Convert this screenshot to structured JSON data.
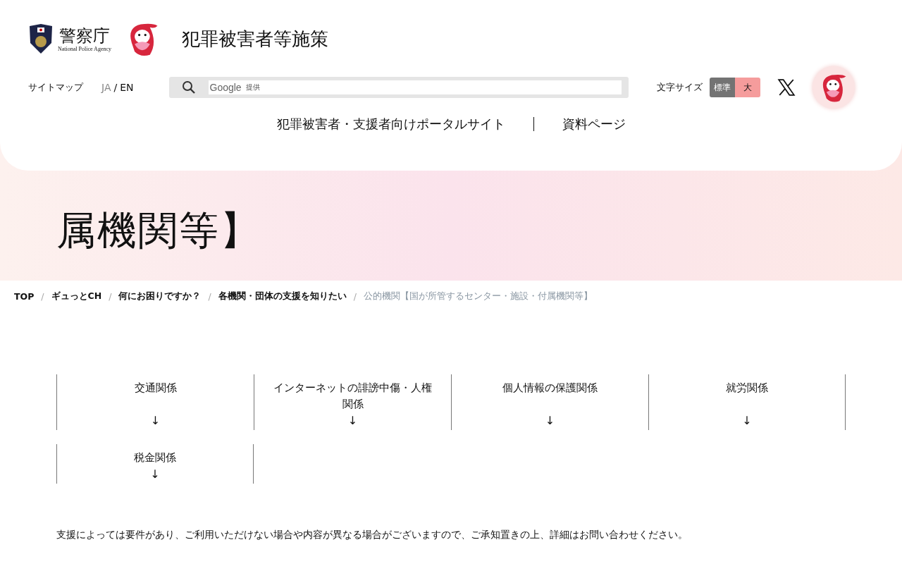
{
  "header": {
    "agency_name": "警察庁",
    "agency_subtitle": "National Police Agency",
    "site_title": "犯罪被害者等施策",
    "utility": {
      "sitemap": "サイトマップ",
      "languages": [
        {
          "label": "JA",
          "selected": true
        },
        {
          "label": "EN",
          "selected": false
        }
      ],
      "language_separator": "/",
      "search": {
        "provider": "Google",
        "provider_note": "提供"
      },
      "font_size": {
        "label": "文字サイズ",
        "options": [
          {
            "label": "標準",
            "selected": true
          },
          {
            "label": "大",
            "selected": false
          }
        ]
      }
    },
    "nav": [
      "犯罪被害者・支援者向けポータルサイト",
      "資料ページ"
    ]
  },
  "page_title": "属機関等】",
  "breadcrumb": [
    "TOP",
    "ギュっとCH",
    "何にお困りですか？",
    "各機関・団体の支援を知りたい",
    "公的機関【国が所管するセンター・施設・付属機関等】"
  ],
  "breadcrumb_separator": "/",
  "categories": [
    {
      "label": "交通関係",
      "arrow": "↓"
    },
    {
      "label": "インターネットの誹謗中傷・人権関係",
      "arrow": "↓"
    },
    {
      "label": "個人情報の保護関係",
      "arrow": "↓"
    },
    {
      "label": "就労関係",
      "arrow": "↓"
    },
    {
      "label": "税金関係",
      "arrow": "↓"
    }
  ],
  "notice": "支援によっては要件があり、ご利用いただけない場合や内容が異なる場合がございますので、ご承知置きの上、詳細はお問い合わせください。"
}
